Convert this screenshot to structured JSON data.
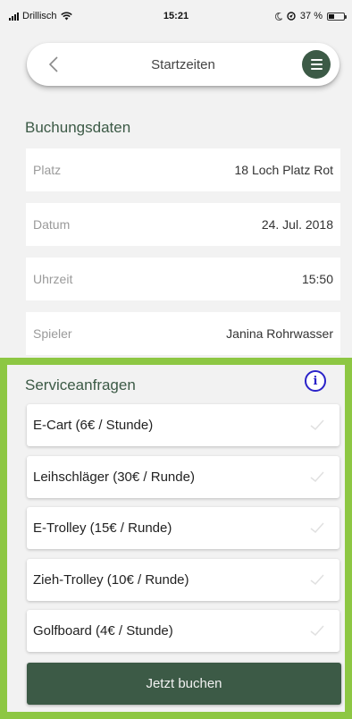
{
  "status_bar": {
    "carrier": "Drillisch",
    "time": "15:21",
    "battery": "37 %"
  },
  "header": {
    "title": "Startzeiten",
    "back_icon": "chevron-left-icon",
    "menu_icon": "menu-icon"
  },
  "booking": {
    "title": "Buchungsdaten",
    "rows": [
      {
        "label": "Platz",
        "value": "18 Loch Platz Rot"
      },
      {
        "label": "Datum",
        "value": "24. Jul. 2018"
      },
      {
        "label": "Uhrzeit",
        "value": "15:50"
      },
      {
        "label": "Spieler",
        "value": "Janina Rohrwasser"
      }
    ]
  },
  "services": {
    "title": "Serviceanfragen",
    "info_icon_glyph": "i",
    "items": [
      {
        "label": "E-Cart (6€ / Stunde)",
        "checked": false
      },
      {
        "label": "Leihschläger (30€ / Runde)",
        "checked": false
      },
      {
        "label": "E-Trolley (15€ / Runde)",
        "checked": false
      },
      {
        "label": "Zieh-Trolley (10€ / Runde)",
        "checked": false
      },
      {
        "label": "Golfboard (4€ / Stunde)",
        "checked": false
      }
    ]
  },
  "action": {
    "book_label": "Jetzt buchen"
  },
  "colors": {
    "primary": "#3c5a46",
    "highlight_frame": "#8dc743",
    "info": "#2a22c8",
    "background": "#f2f2f2"
  }
}
